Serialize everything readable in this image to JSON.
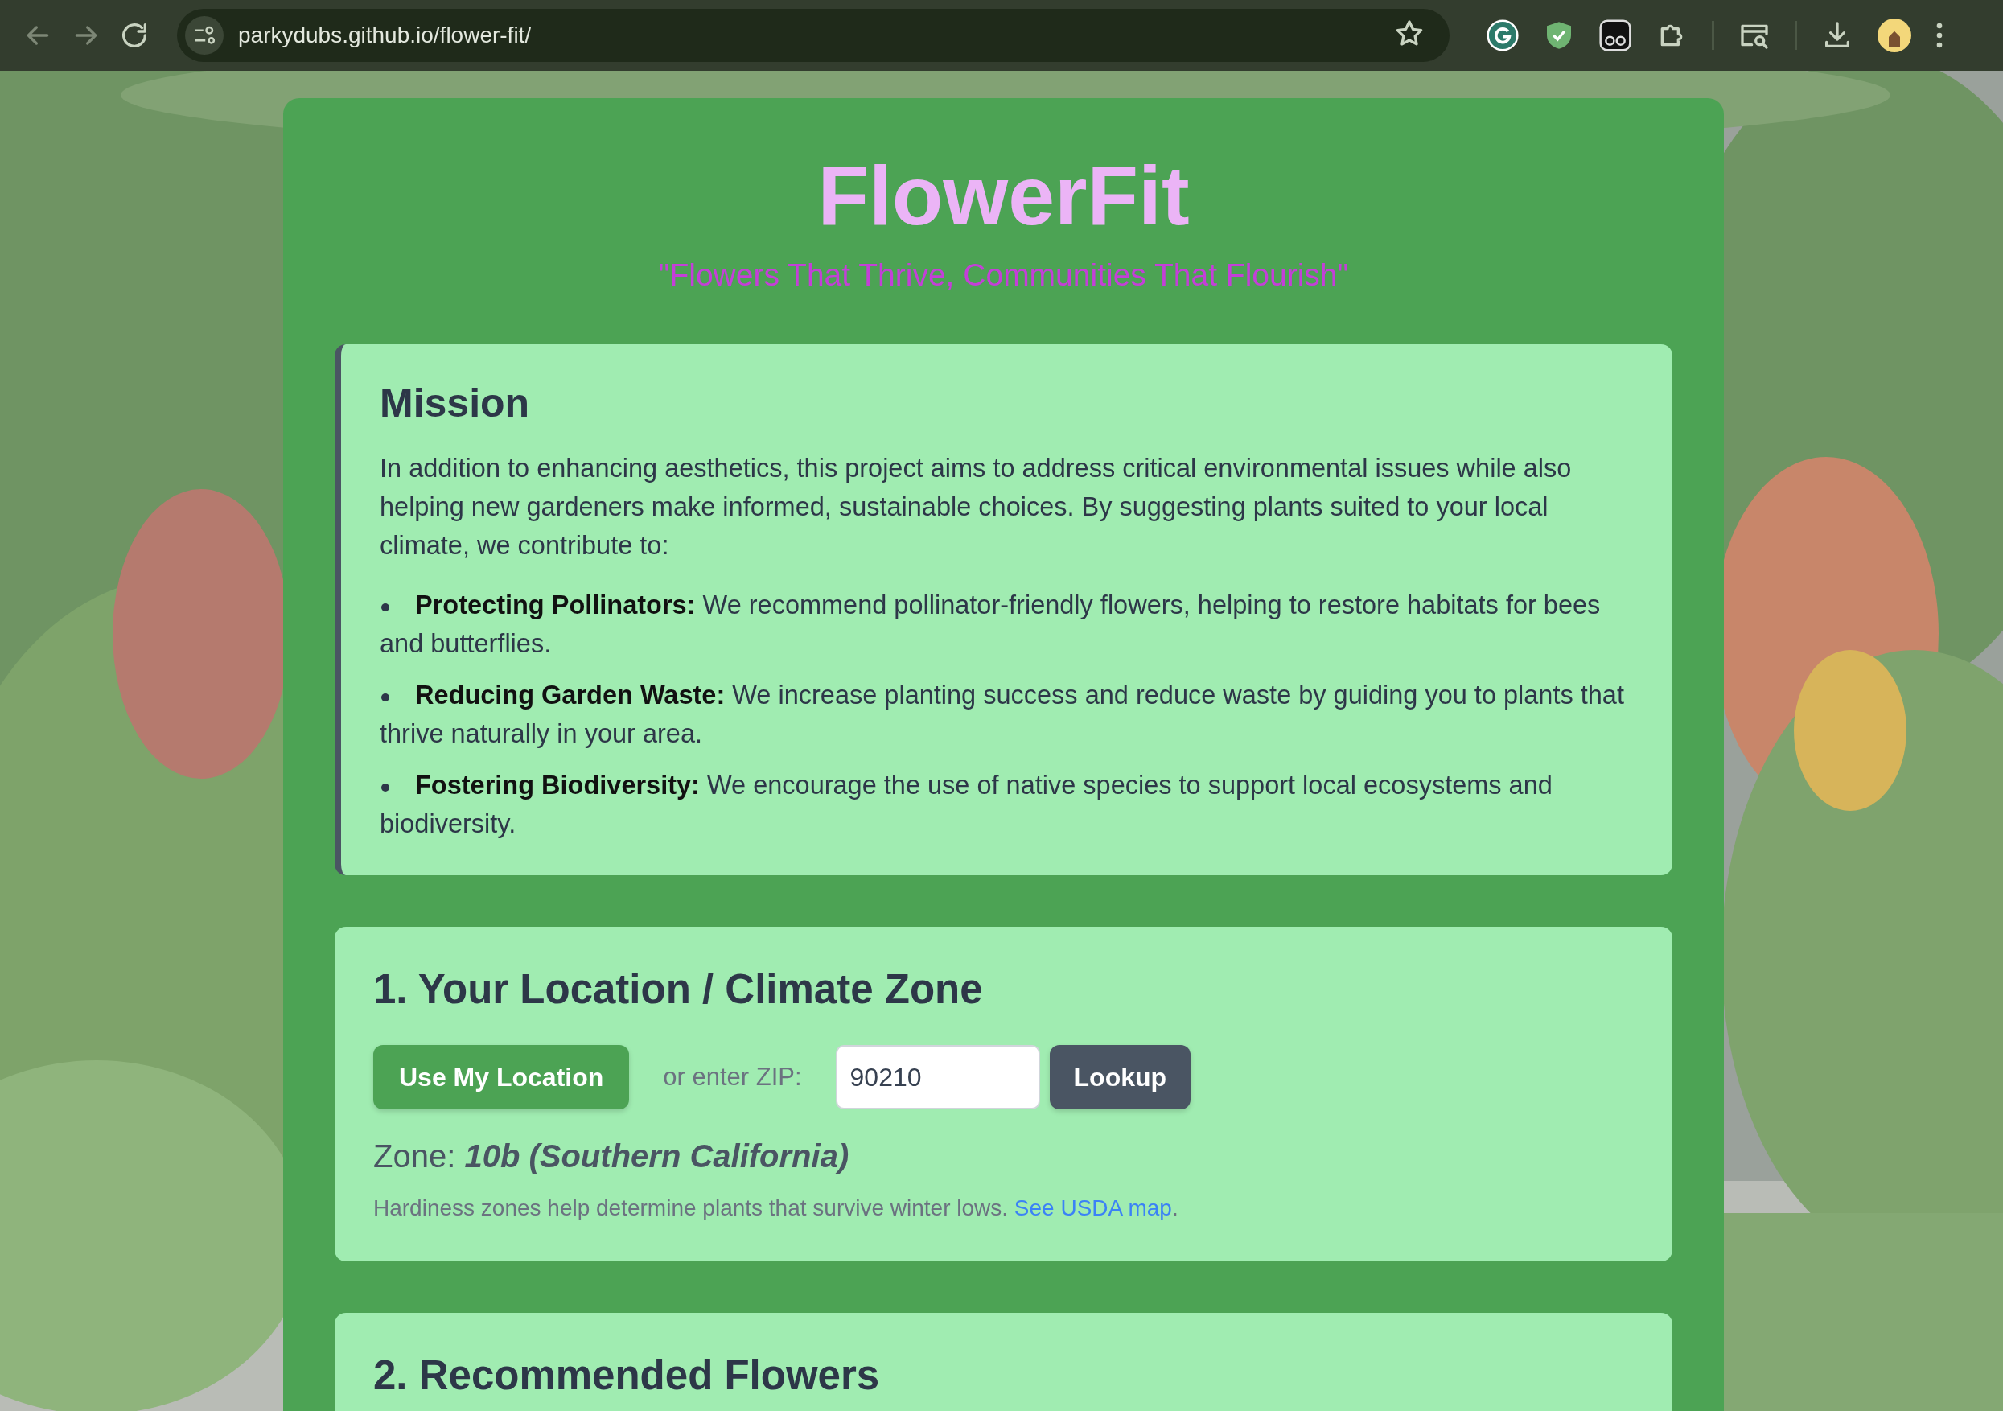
{
  "browser": {
    "url": "parkydubs.github.io/flower-fit/"
  },
  "header": {
    "title": "FlowerFit",
    "tagline": "\"Flowers That Thrive, Communities That Flourish\""
  },
  "mission": {
    "heading": "Mission",
    "intro": "In addition to enhancing aesthetics, this project aims to address critical environmental issues while also helping new gardeners make informed, sustainable choices. By suggesting plants suited to your local climate, we contribute to:",
    "points": [
      {
        "term": "Protecting Pollinators:",
        "text": "We recommend pollinator-friendly flowers, helping to restore habitats for bees and butterflies."
      },
      {
        "term": "Reducing Garden Waste:",
        "text": "We increase planting success and reduce waste by guiding you to plants that thrive naturally in your area."
      },
      {
        "term": "Fostering Biodiversity:",
        "text": "We encourage the use of native species to support local ecosystems and biodiversity."
      }
    ]
  },
  "location": {
    "heading": "1. Your Location / Climate Zone",
    "location_button": "Use My Location",
    "zip_label": "or enter ZIP:",
    "zip": {
      "value": "90210"
    },
    "lookup_button": "Lookup",
    "zone": {
      "label": "Zone:",
      "value": "10b (Southern California)"
    },
    "note": "Hardiness zones help determine plants that survive winter lows.",
    "note_link": "See USDA map",
    "note_end": "."
  },
  "recommendations": {
    "heading": "2. Recommended Flowers"
  }
}
